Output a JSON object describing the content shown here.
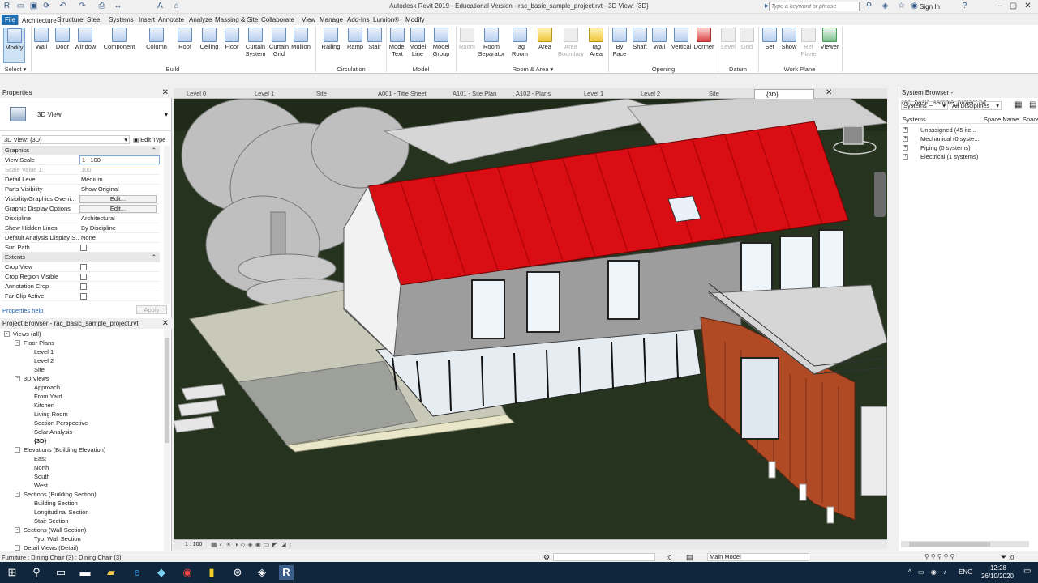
{
  "titlebar": {
    "title": "Autodesk Revit 2019 - Educational Version - rac_basic_sample_project.rvt - 3D View: {3D}",
    "search_placeholder": "Type a keyword or phrase",
    "sign_in": "Sign In"
  },
  "ribbon_tabs": [
    "File",
    "Architecture",
    "Structure",
    "Steel",
    "Systems",
    "Insert",
    "Annotate",
    "Analyze",
    "Massing & Site",
    "Collaborate",
    "View",
    "Manage",
    "Add-Ins",
    "Lumion®",
    "Modify"
  ],
  "ribbon_buttons": {
    "modify": "Modify",
    "wall": "Wall",
    "door": "Door",
    "window": "Window",
    "component": "Component",
    "column": "Column",
    "roof": "Roof",
    "ceiling": "Ceiling",
    "floor": "Floor",
    "curtain_system": "Curtain System",
    "curtain_grid": "Curtain Grid",
    "mullion": "Mullion",
    "railing": "Railing",
    "ramp": "Ramp",
    "stair": "Stair",
    "model_text": "Model Text",
    "model_line": "Model Line",
    "model_group": "Model Group",
    "room": "Room",
    "room_separator": "Room Separator",
    "tag_room": "Tag Room",
    "area": "Area",
    "area_boundary": "Area Boundary",
    "tag_area": "Tag Area",
    "by_face": "By Face",
    "shaft": "Shaft",
    "wall_opening": "Wall",
    "vertical": "Vertical",
    "dormer": "Dormer",
    "level": "Level",
    "grid": "Grid",
    "set": "Set",
    "show": "Show",
    "ref_plane": "Ref Plane",
    "viewer": "Viewer"
  },
  "ribbon_groups": {
    "select": "Select",
    "build": "Build",
    "circulation": "Circulation",
    "model": "Model",
    "room_area": "Room & Area",
    "opening": "Opening",
    "datum": "Datum",
    "work_plane": "Work Plane"
  },
  "properties": {
    "panel_title": "Properties",
    "type_name": "3D View",
    "instance": "3D View: {3D}",
    "edit_type": "Edit Type",
    "rows": [
      {
        "k": "Graphics",
        "cat": true
      },
      {
        "k": "View Scale",
        "v": "1 : 100"
      },
      {
        "k": "Scale Value    1:",
        "v": "100"
      },
      {
        "k": "Detail Level",
        "v": "Medium"
      },
      {
        "k": "Parts Visibility",
        "v": "Show Original"
      },
      {
        "k": "Visibility/Graphics Overri...",
        "v": "Edit...",
        "btn": true
      },
      {
        "k": "Graphic Display Options",
        "v": "Edit...",
        "btn": true
      },
      {
        "k": "Discipline",
        "v": "Architectural"
      },
      {
        "k": "Show Hidden Lines",
        "v": "By Discipline"
      },
      {
        "k": "Default Analysis Display S...",
        "v": "None"
      },
      {
        "k": "Sun Path",
        "v": "",
        "check": true
      },
      {
        "k": "Extents",
        "cat": true
      },
      {
        "k": "Crop View",
        "v": "",
        "check": true
      },
      {
        "k": "Crop Region Visible",
        "v": "",
        "check": true
      },
      {
        "k": "Annotation Crop",
        "v": "",
        "check": true
      },
      {
        "k": "Far Clip Active",
        "v": "",
        "check": true
      }
    ],
    "help": "Properties help",
    "apply": "Apply"
  },
  "project_browser": {
    "title": "Project Browser - rac_basic_sample_project.rvt",
    "nodes": [
      {
        "t": "Views (all)",
        "d": 0,
        "tog": "-"
      },
      {
        "t": "Floor Plans",
        "d": 1,
        "tog": "-"
      },
      {
        "t": "Level 1",
        "d": 2
      },
      {
        "t": "Level 2",
        "d": 2
      },
      {
        "t": "Site",
        "d": 2
      },
      {
        "t": "3D Views",
        "d": 1,
        "tog": "-"
      },
      {
        "t": "Approach",
        "d": 2
      },
      {
        "t": "From Yard",
        "d": 2
      },
      {
        "t": "Kitchen",
        "d": 2
      },
      {
        "t": "Living Room",
        "d": 2
      },
      {
        "t": "Section Perspective",
        "d": 2
      },
      {
        "t": "Solar Analysis",
        "d": 2
      },
      {
        "t": "{3D}",
        "d": 2,
        "bold": true
      },
      {
        "t": "Elevations (Building Elevation)",
        "d": 1,
        "tog": "-"
      },
      {
        "t": "East",
        "d": 2
      },
      {
        "t": "North",
        "d": 2
      },
      {
        "t": "South",
        "d": 2
      },
      {
        "t": "West",
        "d": 2
      },
      {
        "t": "Sections (Building Section)",
        "d": 1,
        "tog": "-"
      },
      {
        "t": "Building Section",
        "d": 2
      },
      {
        "t": "Longitudinal Section",
        "d": 2
      },
      {
        "t": "Stair Section",
        "d": 2
      },
      {
        "t": "Sections (Wall Section)",
        "d": 1,
        "tog": "-"
      },
      {
        "t": "Typ. Wall Section",
        "d": 2
      },
      {
        "t": "Detail Views (Detail)",
        "d": 1,
        "tog": "-"
      }
    ]
  },
  "view_tabs": [
    "Level 0",
    "Level 1",
    "Site",
    "A001 - Title Sheet",
    "A101 - Site Plan",
    "A102 - Plans",
    "Level 1",
    "Level 2",
    "Site",
    "{3D}"
  ],
  "system_browser": {
    "title": "System Browser - rac_basic_sample_project.rvt",
    "filter1": "Systems",
    "filter2": "All Disciplines",
    "col1": "Systems",
    "col2": "Space Name",
    "col3": "Space",
    "items": [
      "Unassigned (45 ite...",
      "Mechanical (0 syste...",
      "Piping (0 systems)",
      "Electrical (1 systems)"
    ]
  },
  "view_bar": {
    "scale": "1 : 100"
  },
  "status": {
    "text": "Furniture : Dining Chair (3) : Dining Chair (3)",
    "zero": ":0",
    "model": "Main Model",
    "filter": ":0"
  },
  "taskbar": {
    "time": "12:28",
    "date": "26/10/2020",
    "lang": "ENG"
  }
}
